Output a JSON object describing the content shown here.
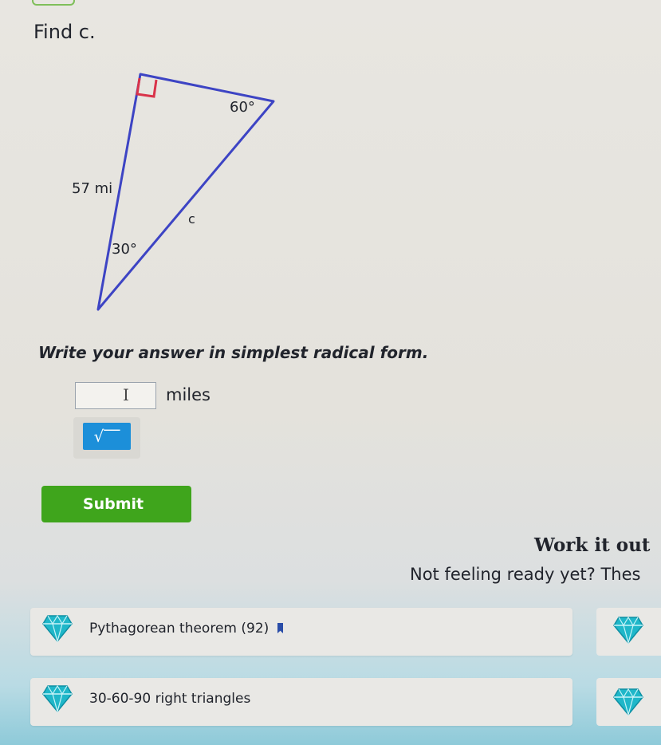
{
  "question": {
    "title": "Find c."
  },
  "diagram": {
    "side_label": "57 mi",
    "hypotenuse_label": "c",
    "top_angle_label": "60°",
    "bottom_angle_label": "30°"
  },
  "answer": {
    "instruction": "Write your answer in simplest radical form.",
    "input_value": "",
    "unit": "miles",
    "sqrt_button_label": "√‾‾"
  },
  "submit_label": "Submit",
  "work_section": {
    "heading": "Work it out",
    "subtext": "Not feeling ready yet? Thes"
  },
  "skills": [
    {
      "label": "Pythagorean theorem (92)"
    },
    {
      "label": "30-60-90 right triangles"
    }
  ],
  "colors": {
    "submit_green": "#3fa51c",
    "sqrt_blue": "#1c8fd9",
    "gem_teal": "#1fb7c9",
    "right_angle_red": "#d9334a",
    "triangle_stroke": "#3d44c4"
  }
}
